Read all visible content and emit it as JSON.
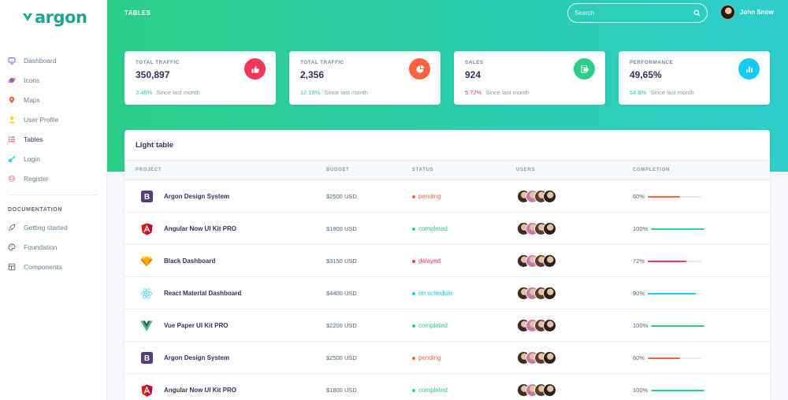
{
  "brand": {
    "name": "argon",
    "color": "#1fa78e"
  },
  "sidebar": {
    "items": [
      {
        "label": "Dashboard",
        "icon": "tv-icon",
        "color": "#5e72e4"
      },
      {
        "label": "Icons",
        "icon": "planet-icon",
        "color": "#5e72e4"
      },
      {
        "label": "Maps",
        "icon": "pin-icon",
        "color": "#fb6340"
      },
      {
        "label": "User Profile",
        "icon": "user-icon",
        "color": "#ffd600"
      },
      {
        "label": "Tables",
        "icon": "bullet-list-icon",
        "color": "#f5365c"
      },
      {
        "label": "Login",
        "icon": "key-icon",
        "color": "#11cdef"
      },
      {
        "label": "Register",
        "icon": "circle-user-icon",
        "color": "#f3a4b5"
      }
    ],
    "doc_heading": "DOCUMENTATION",
    "doc_items": [
      {
        "label": "Getting started",
        "icon": "spaceship-icon"
      },
      {
        "label": "Foundation",
        "icon": "palette-icon"
      },
      {
        "label": "Components",
        "icon": "ui-icon"
      }
    ]
  },
  "header": {
    "title": "TABLES",
    "search_placeholder": "Search",
    "user_name": "John Snow",
    "gradient": [
      "#2dce89",
      "#2dcecc"
    ]
  },
  "stats": [
    {
      "title": "TOTAL TRAFFIC",
      "value": "350,897",
      "pct": "3.48%",
      "direction": "up",
      "since": "Since last month",
      "icon": "thumbs-up-icon",
      "color": "#f5365c"
    },
    {
      "title": "TOTAL TRAFFIC",
      "value": "2,356",
      "pct": "12.18%",
      "direction": "up",
      "since": "Since last month",
      "icon": "pie-chart-icon",
      "color": "#fb6340"
    },
    {
      "title": "SALES",
      "value": "924",
      "pct": "5.72%",
      "direction": "down",
      "since": "Since last month",
      "icon": "money-icon",
      "color": "#2dce89"
    },
    {
      "title": "PERFORMANCE",
      "value": "49,65%",
      "pct": "54.8%",
      "direction": "up",
      "since": "Since last month",
      "icon": "bar-chart-icon",
      "color": "#11cdef"
    }
  ],
  "table": {
    "title": "Light table",
    "headers": [
      "PROJECT",
      "BUDGET",
      "STATUS",
      "USERS",
      "COMPLETION"
    ],
    "rows": [
      {
        "project": "Argon Design System",
        "logo": "bootstrap-icon",
        "budget": "$2500 USD",
        "status": "pending",
        "status_color": "#fb6340",
        "completion": "60%",
        "progress": 0.6,
        "bar_color": "#fb6340"
      },
      {
        "project": "Angular Now UI Kit PRO",
        "logo": "angular-icon",
        "budget": "$1800 USD",
        "status": "completed",
        "status_color": "#2dce89",
        "completion": "100%",
        "progress": 1.0,
        "bar_color": "#2dce89"
      },
      {
        "project": "Black Dashboard",
        "logo": "sketch-icon",
        "budget": "$3150 USD",
        "status": "delayed",
        "status_color": "#f5365c",
        "completion": "72%",
        "progress": 0.72,
        "bar_color": "#f5365c"
      },
      {
        "project": "React Material Dashboard",
        "logo": "react-icon",
        "budget": "$4400 USD",
        "status": "on schedule",
        "status_color": "#11cdef",
        "completion": "90%",
        "progress": 0.9,
        "bar_color": "#11cdef"
      },
      {
        "project": "Vue Paper UI Kit PRO",
        "logo": "vue-icon",
        "budget": "$2200 USD",
        "status": "completed",
        "status_color": "#2dce89",
        "completion": "100%",
        "progress": 1.0,
        "bar_color": "#2dce89"
      },
      {
        "project": "Argon Design System",
        "logo": "bootstrap-icon",
        "budget": "$2500 USD",
        "status": "pending",
        "status_color": "#fb6340",
        "completion": "60%",
        "progress": 0.6,
        "bar_color": "#fb6340"
      },
      {
        "project": "Angular Now UI Kit PRO",
        "logo": "angular-icon",
        "budget": "$1800 USD",
        "status": "completed",
        "status_color": "#2dce89",
        "completion": "100%",
        "progress": 1.0,
        "bar_color": "#2dce89"
      }
    ],
    "avatar_colors": [
      "#3b2a22",
      "#c77ca6",
      "#5a3d31",
      "#2a1f1a"
    ]
  }
}
